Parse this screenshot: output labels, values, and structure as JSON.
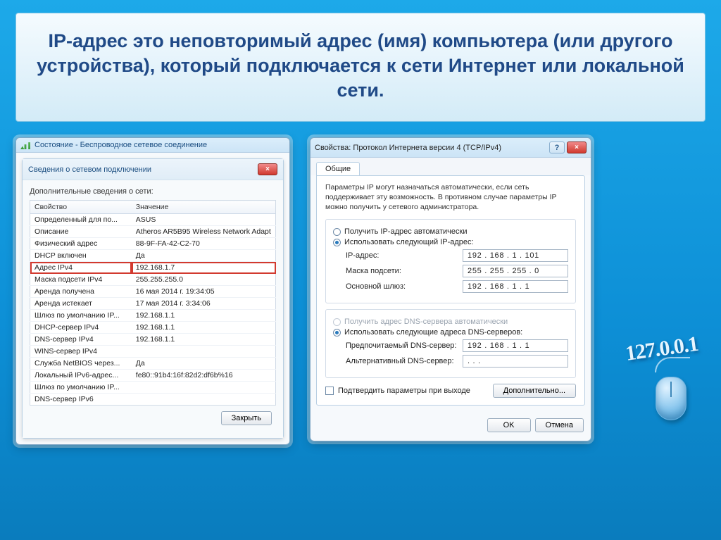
{
  "title": "IP-адрес это неповторимый адрес (имя) компьютера (или другого устройства), который подключается к сети Интернет или локальной сети.",
  "left": {
    "parent_title": "Состояние - Беспроводное сетевое соединение",
    "dialog_title": "Сведения о сетевом подключении",
    "desc": "Дополнительные сведения о сети:",
    "th_prop": "Свойство",
    "th_val": "Значение",
    "rows": [
      {
        "p": "Определенный для по...",
        "v": "ASUS"
      },
      {
        "p": "Описание",
        "v": "Atheros AR5B95 Wireless Network Adapt"
      },
      {
        "p": "Физический адрес",
        "v": "88-9F-FA-42-C2-70"
      },
      {
        "p": "DHCP включен",
        "v": "Да"
      },
      {
        "p": "Адрес IPv4",
        "v": "192.168.1.7",
        "hl": true
      },
      {
        "p": "Маска подсети IPv4",
        "v": "255.255.255.0"
      },
      {
        "p": "Аренда получена",
        "v": "16 мая 2014 г. 19:34:05"
      },
      {
        "p": "Аренда истекает",
        "v": "17 мая 2014 г. 3:34:06"
      },
      {
        "p": "Шлюз по умолчанию IP...",
        "v": "192.168.1.1"
      },
      {
        "p": "DHCP-сервер IPv4",
        "v": "192.168.1.1"
      },
      {
        "p": "DNS-сервер IPv4",
        "v": "192.168.1.1"
      },
      {
        "p": "WINS-сервер IPv4",
        "v": ""
      },
      {
        "p": "Служба NetBIOS через...",
        "v": "Да"
      },
      {
        "p": "Локальный IPv6-адрес...",
        "v": "fe80::91b4:16f:82d2:df6b%16"
      },
      {
        "p": "Шлюз по умолчанию IP...",
        "v": ""
      },
      {
        "p": "DNS-сервер IPv6",
        "v": ""
      }
    ],
    "close_btn": "Закрыть"
  },
  "right": {
    "title": "Свойства: Протокол Интернета версии 4 (TCP/IPv4)",
    "tab": "Общие",
    "hint": "Параметры IP могут назначаться автоматически, если сеть поддерживает эту возможность. В противном случае параметры IP можно получить у сетевого администратора.",
    "r_auto_ip": "Получить IP-адрес автоматически",
    "r_manual_ip": "Использовать следующий IP-адрес:",
    "f_ip_label": "IP-адрес:",
    "f_ip_val": "192 . 168 .  1  . 101",
    "f_mask_label": "Маска подсети:",
    "f_mask_val": "255 . 255 . 255 .  0",
    "f_gw_label": "Основной шлюз:",
    "f_gw_val": "192 . 168 .  1  .  1",
    "r_auto_dns": "Получить адрес DNS-сервера автоматически",
    "r_manual_dns": "Использовать следующие адреса DNS-серверов:",
    "f_dns1_label": "Предпочитаемый DNS-сервер:",
    "f_dns1_val": "192 . 168 .  1  .  1",
    "f_dns2_label": "Альтернативный DNS-сервер:",
    "f_dns2_val": " .   .   . ",
    "chk_confirm": "Подтвердить параметры при выходе",
    "btn_adv": "Дополнительно...",
    "btn_ok": "OK",
    "btn_cancel": "Отмена"
  },
  "decor_text": "127.0.0.1"
}
